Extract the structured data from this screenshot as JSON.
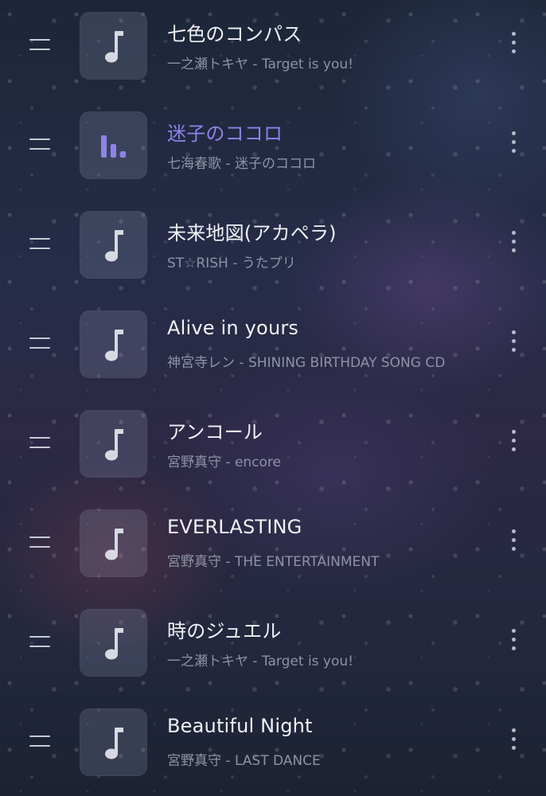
{
  "accent_color": "#8f82ea",
  "tracks": [
    {
      "title": "七色のコンパス",
      "subtitle": "一之瀬トキヤ - Target is you!",
      "state": "idle",
      "icon": "music-note-icon"
    },
    {
      "title": "迷子のココロ",
      "subtitle": "七海春歌 - 迷子のココロ",
      "state": "playing",
      "icon": "equalizer-icon"
    },
    {
      "title": "未来地図(アカペラ)",
      "subtitle": "ST☆RISH - うたプリ",
      "state": "idle",
      "icon": "music-note-icon"
    },
    {
      "title": "Alive in yours",
      "subtitle": "神宮寺レン - SHINING BIRTHDAY SONG CD",
      "state": "idle",
      "icon": "music-note-icon"
    },
    {
      "title": "アンコール",
      "subtitle": "宮野真守 - encore",
      "state": "idle",
      "icon": "music-note-icon"
    },
    {
      "title": "EVERLASTING",
      "subtitle": "宮野真守 - THE ENTERTAINMENT",
      "state": "idle",
      "icon": "music-note-icon"
    },
    {
      "title": "時のジュエル",
      "subtitle": "一之瀬トキヤ - Target is you!",
      "state": "idle",
      "icon": "music-note-icon"
    },
    {
      "title": "Beautiful Night",
      "subtitle": "宮野真守 - LAST DANCE",
      "state": "idle",
      "icon": "music-note-icon"
    }
  ]
}
